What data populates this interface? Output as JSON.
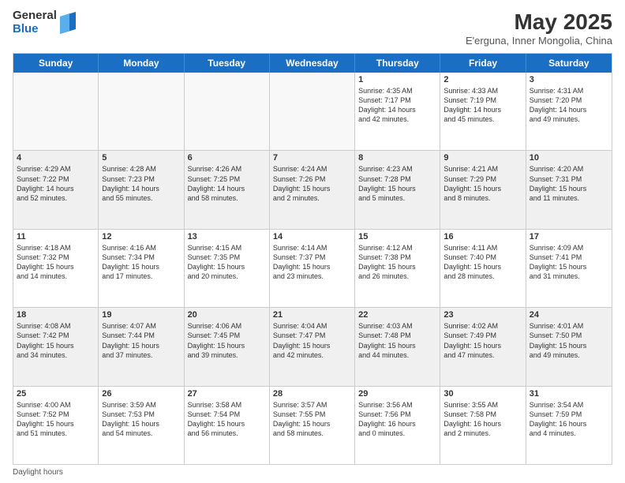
{
  "header": {
    "logo_general": "General",
    "logo_blue": "Blue",
    "title": "May 2025",
    "location": "E'erguna, Inner Mongolia, China"
  },
  "day_headers": [
    "Sunday",
    "Monday",
    "Tuesday",
    "Wednesday",
    "Thursday",
    "Friday",
    "Saturday"
  ],
  "footer": {
    "daylight_label": "Daylight hours"
  },
  "weeks": [
    {
      "days": [
        {
          "num": "",
          "info": "",
          "empty": true
        },
        {
          "num": "",
          "info": "",
          "empty": true
        },
        {
          "num": "",
          "info": "",
          "empty": true
        },
        {
          "num": "",
          "info": "",
          "empty": true
        },
        {
          "num": "1",
          "info": "Sunrise: 4:35 AM\nSunset: 7:17 PM\nDaylight: 14 hours\nand 42 minutes.",
          "empty": false
        },
        {
          "num": "2",
          "info": "Sunrise: 4:33 AM\nSunset: 7:19 PM\nDaylight: 14 hours\nand 45 minutes.",
          "empty": false
        },
        {
          "num": "3",
          "info": "Sunrise: 4:31 AM\nSunset: 7:20 PM\nDaylight: 14 hours\nand 49 minutes.",
          "empty": false
        }
      ]
    },
    {
      "days": [
        {
          "num": "4",
          "info": "Sunrise: 4:29 AM\nSunset: 7:22 PM\nDaylight: 14 hours\nand 52 minutes.",
          "empty": false
        },
        {
          "num": "5",
          "info": "Sunrise: 4:28 AM\nSunset: 7:23 PM\nDaylight: 14 hours\nand 55 minutes.",
          "empty": false
        },
        {
          "num": "6",
          "info": "Sunrise: 4:26 AM\nSunset: 7:25 PM\nDaylight: 14 hours\nand 58 minutes.",
          "empty": false
        },
        {
          "num": "7",
          "info": "Sunrise: 4:24 AM\nSunset: 7:26 PM\nDaylight: 15 hours\nand 2 minutes.",
          "empty": false
        },
        {
          "num": "8",
          "info": "Sunrise: 4:23 AM\nSunset: 7:28 PM\nDaylight: 15 hours\nand 5 minutes.",
          "empty": false
        },
        {
          "num": "9",
          "info": "Sunrise: 4:21 AM\nSunset: 7:29 PM\nDaylight: 15 hours\nand 8 minutes.",
          "empty": false
        },
        {
          "num": "10",
          "info": "Sunrise: 4:20 AM\nSunset: 7:31 PM\nDaylight: 15 hours\nand 11 minutes.",
          "empty": false
        }
      ]
    },
    {
      "days": [
        {
          "num": "11",
          "info": "Sunrise: 4:18 AM\nSunset: 7:32 PM\nDaylight: 15 hours\nand 14 minutes.",
          "empty": false
        },
        {
          "num": "12",
          "info": "Sunrise: 4:16 AM\nSunset: 7:34 PM\nDaylight: 15 hours\nand 17 minutes.",
          "empty": false
        },
        {
          "num": "13",
          "info": "Sunrise: 4:15 AM\nSunset: 7:35 PM\nDaylight: 15 hours\nand 20 minutes.",
          "empty": false
        },
        {
          "num": "14",
          "info": "Sunrise: 4:14 AM\nSunset: 7:37 PM\nDaylight: 15 hours\nand 23 minutes.",
          "empty": false
        },
        {
          "num": "15",
          "info": "Sunrise: 4:12 AM\nSunset: 7:38 PM\nDaylight: 15 hours\nand 26 minutes.",
          "empty": false
        },
        {
          "num": "16",
          "info": "Sunrise: 4:11 AM\nSunset: 7:40 PM\nDaylight: 15 hours\nand 28 minutes.",
          "empty": false
        },
        {
          "num": "17",
          "info": "Sunrise: 4:09 AM\nSunset: 7:41 PM\nDaylight: 15 hours\nand 31 minutes.",
          "empty": false
        }
      ]
    },
    {
      "days": [
        {
          "num": "18",
          "info": "Sunrise: 4:08 AM\nSunset: 7:42 PM\nDaylight: 15 hours\nand 34 minutes.",
          "empty": false
        },
        {
          "num": "19",
          "info": "Sunrise: 4:07 AM\nSunset: 7:44 PM\nDaylight: 15 hours\nand 37 minutes.",
          "empty": false
        },
        {
          "num": "20",
          "info": "Sunrise: 4:06 AM\nSunset: 7:45 PM\nDaylight: 15 hours\nand 39 minutes.",
          "empty": false
        },
        {
          "num": "21",
          "info": "Sunrise: 4:04 AM\nSunset: 7:47 PM\nDaylight: 15 hours\nand 42 minutes.",
          "empty": false
        },
        {
          "num": "22",
          "info": "Sunrise: 4:03 AM\nSunset: 7:48 PM\nDaylight: 15 hours\nand 44 minutes.",
          "empty": false
        },
        {
          "num": "23",
          "info": "Sunrise: 4:02 AM\nSunset: 7:49 PM\nDaylight: 15 hours\nand 47 minutes.",
          "empty": false
        },
        {
          "num": "24",
          "info": "Sunrise: 4:01 AM\nSunset: 7:50 PM\nDaylight: 15 hours\nand 49 minutes.",
          "empty": false
        }
      ]
    },
    {
      "days": [
        {
          "num": "25",
          "info": "Sunrise: 4:00 AM\nSunset: 7:52 PM\nDaylight: 15 hours\nand 51 minutes.",
          "empty": false
        },
        {
          "num": "26",
          "info": "Sunrise: 3:59 AM\nSunset: 7:53 PM\nDaylight: 15 hours\nand 54 minutes.",
          "empty": false
        },
        {
          "num": "27",
          "info": "Sunrise: 3:58 AM\nSunset: 7:54 PM\nDaylight: 15 hours\nand 56 minutes.",
          "empty": false
        },
        {
          "num": "28",
          "info": "Sunrise: 3:57 AM\nSunset: 7:55 PM\nDaylight: 15 hours\nand 58 minutes.",
          "empty": false
        },
        {
          "num": "29",
          "info": "Sunrise: 3:56 AM\nSunset: 7:56 PM\nDaylight: 16 hours\nand 0 minutes.",
          "empty": false
        },
        {
          "num": "30",
          "info": "Sunrise: 3:55 AM\nSunset: 7:58 PM\nDaylight: 16 hours\nand 2 minutes.",
          "empty": false
        },
        {
          "num": "31",
          "info": "Sunrise: 3:54 AM\nSunset: 7:59 PM\nDaylight: 16 hours\nand 4 minutes.",
          "empty": false
        }
      ]
    }
  ]
}
